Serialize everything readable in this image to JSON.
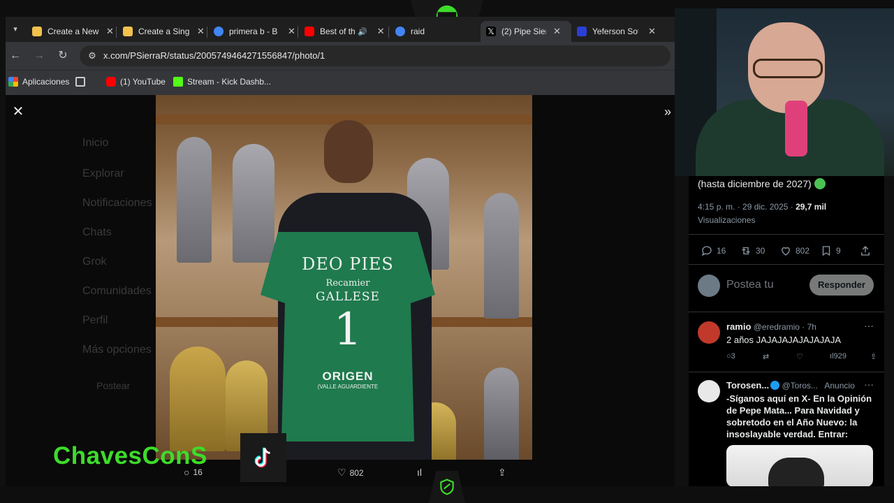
{
  "tabs": [
    {
      "label": "Create a New",
      "active": false,
      "favicon_color": "#f2c14e"
    },
    {
      "label": "Create a Sing",
      "active": false,
      "favicon_color": "#f2c14e"
    },
    {
      "label": "primera b - B",
      "active": false,
      "favicon_color": "#4285f4"
    },
    {
      "label": "Best of th",
      "active": false,
      "favicon_color": "#ff0000"
    },
    {
      "label": "raid",
      "active": false,
      "favicon_color": "#4285f4"
    },
    {
      "label": "(2) Pipe Sierr",
      "active": true,
      "favicon_color": "#ffffff"
    },
    {
      "label": "Yeferson Sot",
      "active": false,
      "favicon_color": "#2b3fd6"
    }
  ],
  "toolbar": {
    "url": "x.com/PSierraR/status/2005749464271556847/photo/1"
  },
  "bookmarks": [
    {
      "label": "Aplicaciones",
      "icon": "apps-grid-icon"
    },
    {
      "label": "",
      "icon": "grid-icon"
    },
    {
      "label": "(1) YouTube",
      "icon": "youtube-icon"
    },
    {
      "label": "Stream - Kick Dashb...",
      "icon": "kick-icon"
    }
  ],
  "background_nav": [
    "Inicio",
    "Explorar",
    "Notificaciones",
    "Chats",
    "Grok",
    "Comunidades",
    "Perfil",
    "Más opciones",
    "Postear"
  ],
  "photo": {
    "jersey_sponsor": "DEO PIES",
    "jersey_sub": "Recamier",
    "jersey_name": "GALLESE",
    "jersey_number": "1",
    "jersey_bottom": "ORIGEN",
    "jersey_bottom_sub": "(VALLE AGUARDIENTE"
  },
  "photo_actions": {
    "replies": "16",
    "likes": "802"
  },
  "tweet": {
    "text": "(hasta diciembre de 2027)",
    "time": "4:15 p. m. · 29 dic. 2025 · ",
    "views_count": "29,7 mil",
    "views_label": "Visualizaciones",
    "stats": {
      "replies": "16",
      "reposts": "30",
      "likes": "802",
      "bookmarks": "9"
    }
  },
  "reply_box": {
    "placeholder": "Postea tu",
    "button": "Responder"
  },
  "comments": [
    {
      "name": "ramio",
      "handle": "@eredramio · 7h",
      "text": "2 años JAJAJAJAJAJAJAJA",
      "replies": "3",
      "views": "929"
    },
    {
      "name": "Torosen...",
      "handle": "@Toros...",
      "tag": "Anuncio",
      "text": "-Síganos aquí en X- En la Opinión de Pepe Mata... Para Navidad y sobretodo en el Año Nuevo: la insoslayable verdad. Entrar:"
    }
  ],
  "overlay": {
    "brand": "ChavesConS"
  },
  "colors": {
    "brand_green": "#3ddc2a",
    "x_blue": "#1d9bf0",
    "jersey_green": "#1f7a4e"
  }
}
